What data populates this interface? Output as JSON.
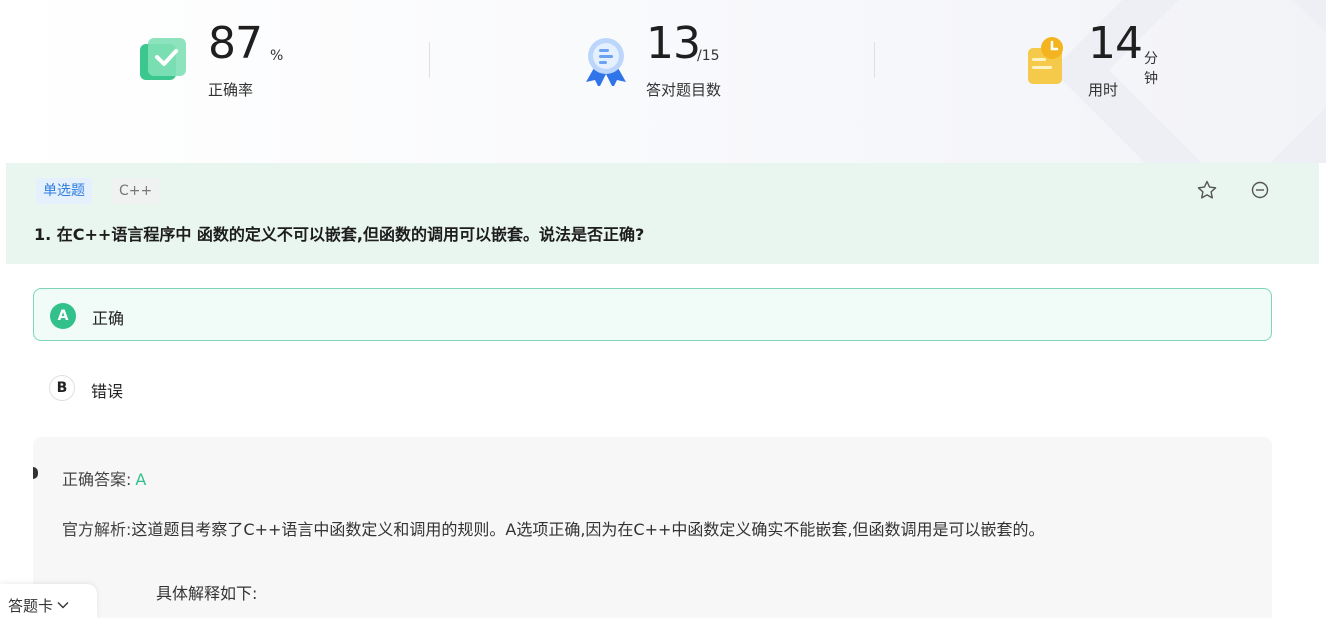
{
  "stats": [
    {
      "value": "87",
      "unit": "%",
      "label": "正确率",
      "icon": "accuracy-check-icon"
    },
    {
      "value": "13",
      "unit": "/15",
      "label": "答对题目数",
      "icon": "badge-award-icon"
    },
    {
      "value": "14",
      "unit": "分钟",
      "label": "用时",
      "icon": "clock-clipboard-icon"
    }
  ],
  "question": {
    "type_tag": "单选题",
    "subject_tag": "C++",
    "title": "1. 在C++语言程序中 函数的定义不可以嵌套,但函数的调用可以嵌套。说法是否正确?",
    "favorite_icon": "star-icon",
    "remove_icon": "minus-circle-icon"
  },
  "options": [
    {
      "letter": "A",
      "text": "正确",
      "selected": true
    },
    {
      "letter": "B",
      "text": "错误",
      "selected": false
    }
  ],
  "analysis": {
    "answer_label": "正确答案:",
    "answer_value": "A",
    "official_label": "官方解析:",
    "official_text": "这道题目考察了C++语言中函数定义和调用的规则。A选项正确,因为在C++中函数定义确实不能嵌套,但函数调用是可以嵌套的。",
    "detail_heading": "具体解释如下:"
  },
  "answer_card": {
    "label": "答题卡"
  },
  "colors": {
    "accent_green": "#32c18b",
    "tag_blue": "#2f7ee0",
    "question_bg": "#e9f5ef"
  }
}
